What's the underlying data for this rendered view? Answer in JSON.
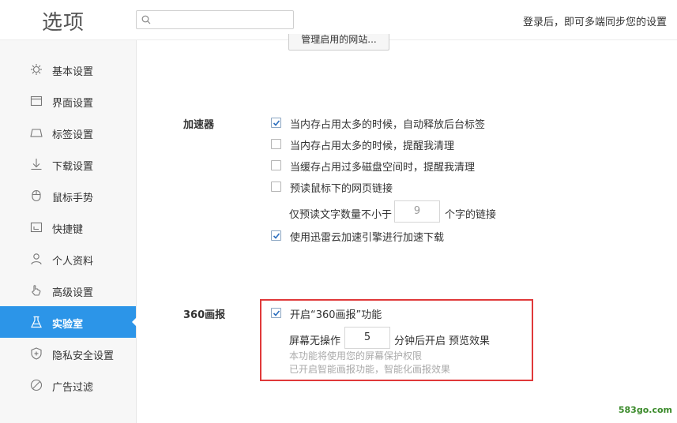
{
  "header": {
    "title": "选项",
    "search_placeholder": "",
    "login_text": "登录后，即可多端同步您的设置"
  },
  "sidebar": {
    "items": [
      {
        "label": "基本设置",
        "icon": "gear-icon"
      },
      {
        "label": "界面设置",
        "icon": "window-icon"
      },
      {
        "label": "标签设置",
        "icon": "tab-icon"
      },
      {
        "label": "下载设置",
        "icon": "download-icon"
      },
      {
        "label": "鼠标手势",
        "icon": "mouse-icon"
      },
      {
        "label": "快捷键",
        "icon": "keyboard-icon"
      },
      {
        "label": "个人资料",
        "icon": "person-icon"
      },
      {
        "label": "高级设置",
        "icon": "hand-icon"
      },
      {
        "label": "实验室",
        "icon": "flask-icon",
        "active": true
      },
      {
        "label": "隐私安全设置",
        "icon": "shield-icon"
      },
      {
        "label": "广告过滤",
        "icon": "block-icon"
      }
    ]
  },
  "main": {
    "manage_button": "管理启用的网站...",
    "accelerator": {
      "label": "加速器",
      "options": [
        {
          "text": "当内存占用太多的时候，自动释放后台标签",
          "checked": true
        },
        {
          "text": "当内存占用太多的时候，提醒我清理",
          "checked": false
        },
        {
          "text": "当缓存占用过多磁盘空间时，提醒我清理",
          "checked": false
        },
        {
          "text": "预读鼠标下的网页链接",
          "checked": false
        }
      ],
      "preread_prefix": "仅预读文字数量不小于",
      "preread_value": "9",
      "preread_suffix": "个字的链接",
      "xunlei": {
        "text": "使用迅雷云加速引擎进行加速下载",
        "checked": true
      }
    },
    "huabao": {
      "label": "360画报",
      "enable": {
        "text": "开启“360画报”功能",
        "checked": true
      },
      "idle_prefix": "屏幕无操作",
      "idle_value": "5",
      "idle_suffix": "分钟后开启",
      "preview_link": "预览效果",
      "hint1": "本功能将使用您的屏幕保护权限",
      "hint2": "已开启智能画报功能，智能化画报效果"
    }
  },
  "watermark": "583go.com",
  "colors": {
    "accent": "#2c95e8",
    "highlight": "#e0393a",
    "link": "#2c8de0"
  }
}
